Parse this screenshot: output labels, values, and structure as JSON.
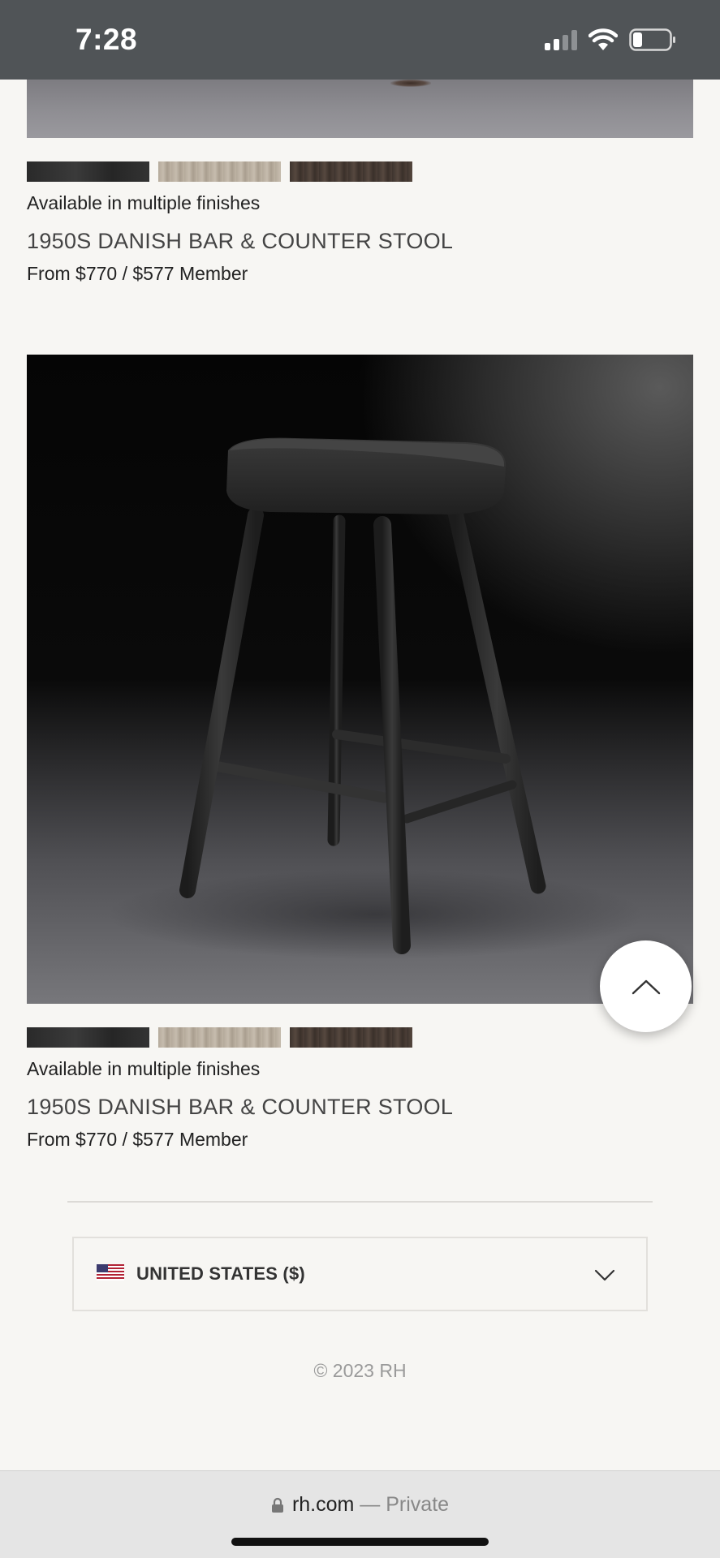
{
  "status_bar": {
    "time": "7:28"
  },
  "products": [
    {
      "swatches": [
        "black",
        "oak",
        "walnut"
      ],
      "finishes_text": "Available in multiple finishes",
      "title": "1950S DANISH BAR & COUNTER STOOL",
      "price": "From $770 / $577 Member"
    },
    {
      "swatches": [
        "black",
        "oak",
        "walnut"
      ],
      "finishes_text": "Available in multiple finishes",
      "title": "1950S DANISH BAR & COUNTER STOOL",
      "price": "From $770 / $577 Member"
    }
  ],
  "footer": {
    "country": "UNITED STATES ($)",
    "copyright": "© 2023 RH"
  },
  "browser": {
    "domain": "rh.com",
    "separator": " — ",
    "mode": "Private"
  },
  "icons": {
    "signal": "cellular-signal-icon",
    "wifi": "wifi-icon",
    "battery": "battery-icon",
    "scroll_top": "chevron-up-icon",
    "country_toggle": "chevron-down-icon",
    "lock": "lock-icon",
    "flag": "us-flag-icon"
  }
}
